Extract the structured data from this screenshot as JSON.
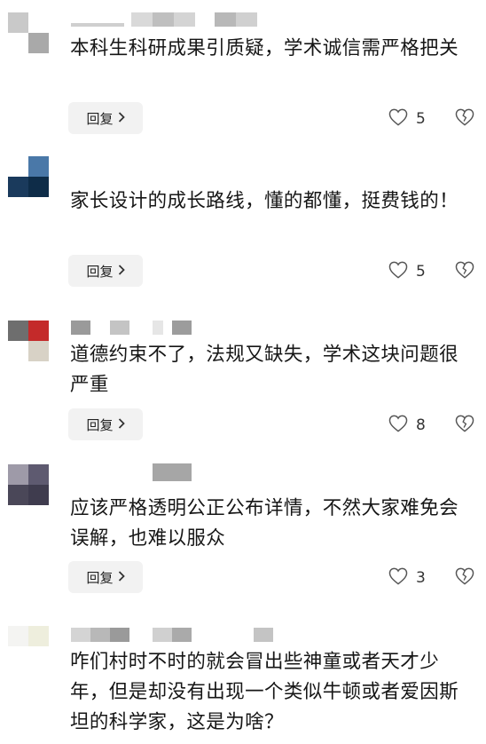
{
  "comments": [
    {
      "text": "本科生科研成果引质疑，学术诚信需严格把关",
      "reply_label": "回复",
      "likes": "5",
      "avatar_colors": [
        "#c9c9c9",
        "#ffffff",
        "#ffffff",
        "#a9a9a9"
      ],
      "name_colors": [
        "#d4d4d4",
        "#bfbfbf",
        "#d9d9d9",
        "#c4c4c4",
        "#d0d0d0",
        "#b8b8b8",
        "#cccccc"
      ]
    },
    {
      "text": "家长设计的成长路线，懂的都懂，挺费钱的！",
      "reply_label": "回复",
      "likes": "5",
      "avatar_colors": [
        "#ffffff",
        "#4a78a8",
        "#1a3a5c",
        "#0e2c48"
      ],
      "name_colors": []
    },
    {
      "text": "道德约束不了，法规又缺失，学术这块问题很严重",
      "reply_label": "回复",
      "likes": "8",
      "avatar_colors": [
        "#6e6e6e",
        "#c42a2a",
        "#ffffff",
        "#d8d2c6"
      ],
      "name_colors": [
        "#9a9a9a",
        "#c4c4c4",
        "#d6d6d6",
        "#9c9c9c"
      ]
    },
    {
      "text": "应该严格透明公正公布详情，不然大家难免会误解，也难以服众",
      "reply_label": "回复",
      "likes": "3",
      "avatar_colors": [
        "#9e9aa8",
        "#5e5a70",
        "#4a4758",
        "#3f3c4e"
      ],
      "name_colors": [
        "#a6a6a6"
      ]
    },
    {
      "text": "咋们村时不时的就会冒出些神童或者天才少年，但是却没有出现一个类似牛顿或者爱因斯坦的科学家，这是为啥？",
      "avatar_colors": [
        "#f4f4f2",
        "#eeeedd",
        "#ffffff",
        "#ffffff"
      ],
      "name_colors": [
        "#d4d4d4",
        "#b8b8b8",
        "#9a9a9a",
        "#d0d0d0",
        "#aaaaaa",
        "#c4c4c4"
      ]
    }
  ],
  "icons": {
    "like": "heart-outline-icon",
    "dislike": "broken-heart-icon",
    "chevron": "chevron-right-icon"
  },
  "colors": {
    "text": "#161616",
    "button_bg": "#f2f2f2",
    "icon": "#555555"
  }
}
